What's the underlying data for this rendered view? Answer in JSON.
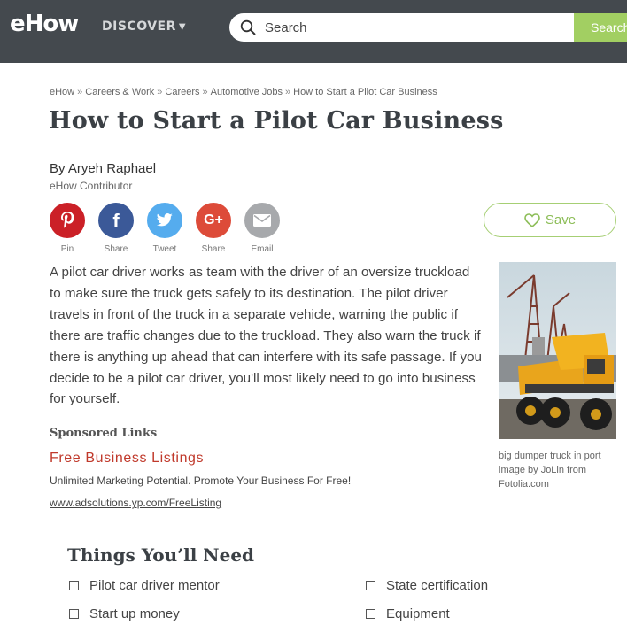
{
  "header": {
    "logo": "eHow",
    "discover_label": "DISCOVER",
    "search_placeholder": "Search",
    "search_button": "Search"
  },
  "breadcrumb": [
    "eHow",
    "Careers & Work",
    "Careers",
    "Automotive Jobs",
    "How to Start a Pilot Car Business"
  ],
  "article": {
    "title": "How to Start a Pilot Car Business",
    "author": "By Aryeh Raphael",
    "role": "eHow Contributor",
    "intro": "A pilot car driver works as team with the driver of an oversize truckload to make sure the truck gets safely to its destination. The pilot driver travels in front of the truck in a separate vehicle, warning the public if there are traffic changes due to the truckload. They also warn the truck if there is anything up ahead that can interfere with its safe passage. If you decide to be a pilot car driver, you'll most likely need to go into business for yourself.",
    "image_caption": "big dumper truck in port image by JoLin from Fotolia.com"
  },
  "social": [
    {
      "label": "Pin",
      "icon": "pinterest-icon",
      "color": "#cb2027"
    },
    {
      "label": "Share",
      "icon": "facebook-icon",
      "color": "#3b5998"
    },
    {
      "label": "Tweet",
      "icon": "twitter-icon",
      "color": "#55acee"
    },
    {
      "label": "Share",
      "icon": "google-plus-icon",
      "color": "#dd4b39"
    },
    {
      "label": "Email",
      "icon": "email-icon",
      "color": "#a7a9ac"
    }
  ],
  "save_label": "Save",
  "sponsored": {
    "heading": "Sponsored Links",
    "ad_title": "Free Business Listings",
    "ad_desc": "Unlimited Marketing Potential. Promote Your Business For Free!",
    "ad_url": "www.adsolutions.yp.com/FreeListing"
  },
  "things": {
    "heading": "Things You’ll Need",
    "items": [
      "Pilot car driver mentor",
      "State certification",
      "Start up money",
      "Equipment"
    ]
  },
  "colors": {
    "header_bg": "#44494e",
    "search_button": "#a2cf62",
    "save_accent": "#8cbd57",
    "ad_title": "#c0392b"
  }
}
